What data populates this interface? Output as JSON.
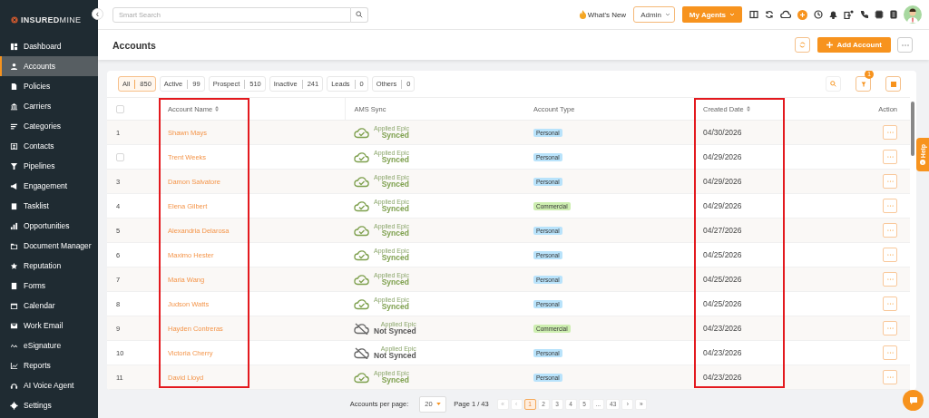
{
  "sidebar": {
    "logo": "**INSURED**MINE",
    "collapse": "‹",
    "items": [
      {
        "label": "Dashboard",
        "selected": false
      },
      {
        "label": "Accounts",
        "selected": true
      },
      {
        "label": "Policies",
        "selected": false
      },
      {
        "label": "Carriers",
        "selected": false
      },
      {
        "label": "Categories",
        "selected": false
      },
      {
        "label": "Contacts",
        "selected": false
      },
      {
        "label": "Pipelines",
        "selected": false
      },
      {
        "label": "Engagement",
        "selected": false
      },
      {
        "label": "Tasklist",
        "selected": false
      },
      {
        "label": "Opportunities",
        "selected": false
      },
      {
        "label": "Document Manager",
        "selected": false
      },
      {
        "label": "Reputation",
        "selected": false
      },
      {
        "label": "Forms",
        "selected": false
      },
      {
        "label": "Calendar",
        "selected": false
      },
      {
        "label": "Work Email",
        "selected": false
      },
      {
        "label": "eSignature",
        "selected": false
      },
      {
        "label": "Reports",
        "selected": false
      },
      {
        "label": "AI Voice Agent",
        "selected": false
      },
      {
        "label": "Settings",
        "selected": false
      }
    ]
  },
  "topbar": {
    "search": {
      "placeholder": "Smart Search"
    },
    "whats_new": "What's New",
    "role": "Admin",
    "agents": "My Agents"
  },
  "header": {
    "title": "Accounts",
    "add_button": "Add Account"
  },
  "filters": [
    {
      "label": "All",
      "count": "850",
      "selected": true
    },
    {
      "label": "Active",
      "count": "99",
      "selected": false
    },
    {
      "label": "Prospect",
      "count": "510",
      "selected": false
    },
    {
      "label": "Inactive",
      "count": "241",
      "selected": false
    },
    {
      "label": "Leads",
      "count": "0",
      "selected": false
    },
    {
      "label": "Others",
      "count": "0",
      "selected": false
    }
  ],
  "filter_badge": "1",
  "table": {
    "columns": [
      {
        "kind": "checkbox",
        "checked": false
      },
      {
        "kind": "text",
        "label": "Account Name",
        "sortable": true,
        "highlighted": true
      },
      {
        "kind": "text",
        "label": "AMS Sync",
        "sortable": false,
        "highlighted": false
      },
      {
        "kind": "text",
        "label": "Account Type",
        "sortable": false,
        "highlighted": false
      },
      {
        "kind": "text",
        "label": "Created Date",
        "sortable": true,
        "highlighted": true
      },
      {
        "kind": "text",
        "label": "Action",
        "sortable": false,
        "highlighted": false
      }
    ],
    "rows": [
      {
        "kind": "number",
        "number": "1",
        "name": "Shawn Mays",
        "sync_label": "Applied Epic",
        "sync": "Synced",
        "synced": true,
        "type": "Personal",
        "color": "#b9e3fb",
        "created": "04/30/2026"
      },
      {
        "kind": "checkbox",
        "checked": false,
        "name": "Trent Weeks",
        "sync_label": "Applied Epic",
        "sync": "Synced",
        "synced": true,
        "type": "Personal",
        "color": "#b9e3fb",
        "created": "04/29/2026"
      },
      {
        "kind": "number",
        "number": "3",
        "name": "Damon Salvatore",
        "sync_label": "Applied Epic",
        "sync": "Synced",
        "synced": true,
        "type": "Personal",
        "color": "#b9e3fb",
        "created": "04/29/2026"
      },
      {
        "kind": "number",
        "number": "4",
        "name": "Elena Gilbert",
        "sync_label": "Applied Epic",
        "sync": "Synced",
        "synced": true,
        "type": "Commercial",
        "color": "#cdeeb0",
        "created": "04/29/2026"
      },
      {
        "kind": "number",
        "number": "5",
        "name": "Alexandria Delarosa",
        "sync_label": "Applied Epic",
        "sync": "Synced",
        "synced": true,
        "type": "Personal",
        "color": "#b9e3fb",
        "created": "04/27/2026"
      },
      {
        "kind": "number",
        "number": "6",
        "name": "Maximo Hester",
        "sync_label": "Applied Epic",
        "sync": "Synced",
        "synced": true,
        "type": "Personal",
        "color": "#b9e3fb",
        "created": "04/25/2026"
      },
      {
        "kind": "number",
        "number": "7",
        "name": "Maria Wang",
        "sync_label": "Applied Epic",
        "sync": "Synced",
        "synced": true,
        "type": "Personal",
        "color": "#b9e3fb",
        "created": "04/25/2026"
      },
      {
        "kind": "number",
        "number": "8",
        "name": "Judson Watts",
        "sync_label": "Applied Epic",
        "sync": "Synced",
        "synced": true,
        "type": "Personal",
        "color": "#b9e3fb",
        "created": "04/25/2026"
      },
      {
        "kind": "number",
        "number": "9",
        "name": "Hayden Contreras",
        "sync_label": "Applied Epic",
        "sync": "Not Synced",
        "synced": false,
        "type": "Commercial",
        "color": "#cdeeb0",
        "created": "04/23/2026"
      },
      {
        "kind": "number",
        "number": "10",
        "name": "Victoria Cherry",
        "sync_label": "Applied Epic",
        "sync": "Not Synced",
        "synced": false,
        "type": "Personal",
        "color": "#b9e3fb",
        "created": "04/23/2026"
      },
      {
        "kind": "number",
        "number": "11",
        "name": "David Lloyd",
        "sync_label": "Applied Epic",
        "sync": "Synced",
        "synced": true,
        "type": "Personal",
        "color": "#b9e3fb",
        "created": "04/23/2026"
      }
    ]
  },
  "pager": {
    "per_page_label": "Accounts per page:",
    "per_page": "20",
    "page_info": "Page 1 / 43",
    "pages": [
      {
        "label": "«",
        "selected": false,
        "disabled": true
      },
      {
        "label": "‹",
        "selected": false,
        "disabled": true
      },
      {
        "label": "1",
        "selected": true,
        "disabled": false
      },
      {
        "label": "2",
        "selected": false,
        "disabled": false
      },
      {
        "label": "3",
        "selected": false,
        "disabled": false
      },
      {
        "label": "4",
        "selected": false,
        "disabled": false
      },
      {
        "label": "5",
        "selected": false,
        "disabled": false
      },
      {
        "label": "...",
        "selected": false,
        "disabled": false
      },
      {
        "label": "43",
        "selected": false,
        "disabled": false
      },
      {
        "label": "›",
        "selected": false,
        "disabled": false
      },
      {
        "label": "»",
        "selected": false,
        "disabled": false
      }
    ]
  },
  "help": "Help"
}
